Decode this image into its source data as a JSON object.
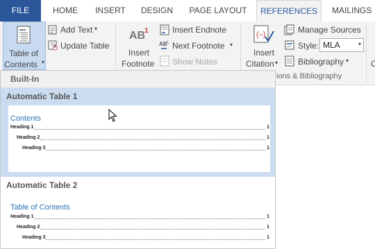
{
  "tabs": {
    "file": "FILE",
    "home": "HOME",
    "insert": "INSERT",
    "design": "DESIGN",
    "page_layout": "PAGE LAYOUT",
    "references": "REFERENCES",
    "mailings": "MAILINGS"
  },
  "ribbon": {
    "toc_line1": "Table of",
    "toc_line2": "Contents",
    "add_text": "Add Text",
    "update_table": "Update Table",
    "insert_footnote_line1": "Insert",
    "insert_footnote_line2": "Footnote",
    "footnote_icon_text": "AB",
    "footnote_icon_sup": "1",
    "insert_endnote": "Insert Endnote",
    "next_footnote": "Next Footnote",
    "show_notes": "Show Notes",
    "insert_citation_line1": "Insert",
    "insert_citation_line2": "Citation",
    "manage_sources": "Manage Sources",
    "style_label": "Style:",
    "style_value": "MLA",
    "bibliography": "Bibliography",
    "group_citations": "ions & Bibliography",
    "next_group_partial": "C"
  },
  "dropdown": {
    "section_header": "Built-In",
    "items": [
      {
        "title": "Automatic Table 1",
        "heading": "Contents",
        "entries": [
          {
            "label": "Heading 1",
            "page": "1"
          },
          {
            "label": "Heading 2",
            "page": "1"
          },
          {
            "label": "Heading 3",
            "page": "1"
          }
        ]
      },
      {
        "title": "Automatic Table 2",
        "heading": "Table of Contents",
        "entries": [
          {
            "label": "Heading 1",
            "page": "1"
          },
          {
            "label": "Heading 2",
            "page": "1"
          },
          {
            "label": "Heading 3",
            "page": "1"
          }
        ]
      }
    ]
  },
  "colors": {
    "file_tab": "#2b579a",
    "accent": "#2b579a",
    "hover": "#cbdcf0",
    "toc_heading": "#2e74b5"
  }
}
